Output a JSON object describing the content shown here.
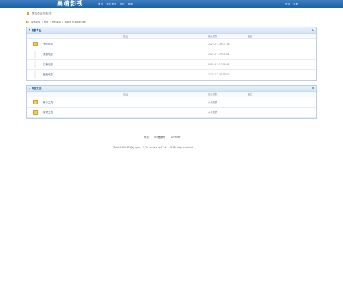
{
  "header": {
    "logo_text": "高清影视",
    "nav": [
      "首页",
      "论坛首页",
      "排行",
      "帮助"
    ],
    "user_links": [
      "登录",
      "注册"
    ]
  },
  "notice": {
    "text": "暂无论坛发帖公告"
  },
  "breadcrumb": [
    "高清影视",
    "首页",
    "在线影片",
    "论坛首页-www.xxxx"
  ],
  "sections": [
    {
      "title": "电影专区",
      "columns": {
        "name": "论坛",
        "last_post": "最后发表",
        "moderator": "版主"
      },
      "rows": [
        {
          "name": "大陆电影",
          "time": "2022-07-16 07:16",
          "mod": ""
        },
        {
          "name": "港台电影",
          "time": "2022-07-19 01:01",
          "mod": ""
        },
        {
          "name": "日韩电影",
          "time": "2022-07-17 01:02",
          "mod": ""
        },
        {
          "name": "欧美电影",
          "time": "2022-07-16 15:02",
          "mod": ""
        }
      ]
    },
    {
      "title": "网友交流",
      "columns": {
        "name": "论坛",
        "last_post": "最后发表",
        "moderator": "版主"
      },
      "rows": [
        {
          "name": "新手交流",
          "time": "从未发表",
          "mod": ""
        },
        {
          "name": "管理交流",
          "time": "从未发表",
          "mod": ""
        }
      ]
    }
  ],
  "footer": {
    "links": [
      "联系",
      "ICP备案号",
      "Archiver"
    ],
    "info": "Total 0.000053(s) query 2, Time now is:07-17 13:18, Gzip enabled"
  },
  "colors": {
    "topbar": "#1b5fa6",
    "panel_border": "#b9cfe7",
    "link": "#1f4e8a",
    "folder": "#f4cd55"
  }
}
